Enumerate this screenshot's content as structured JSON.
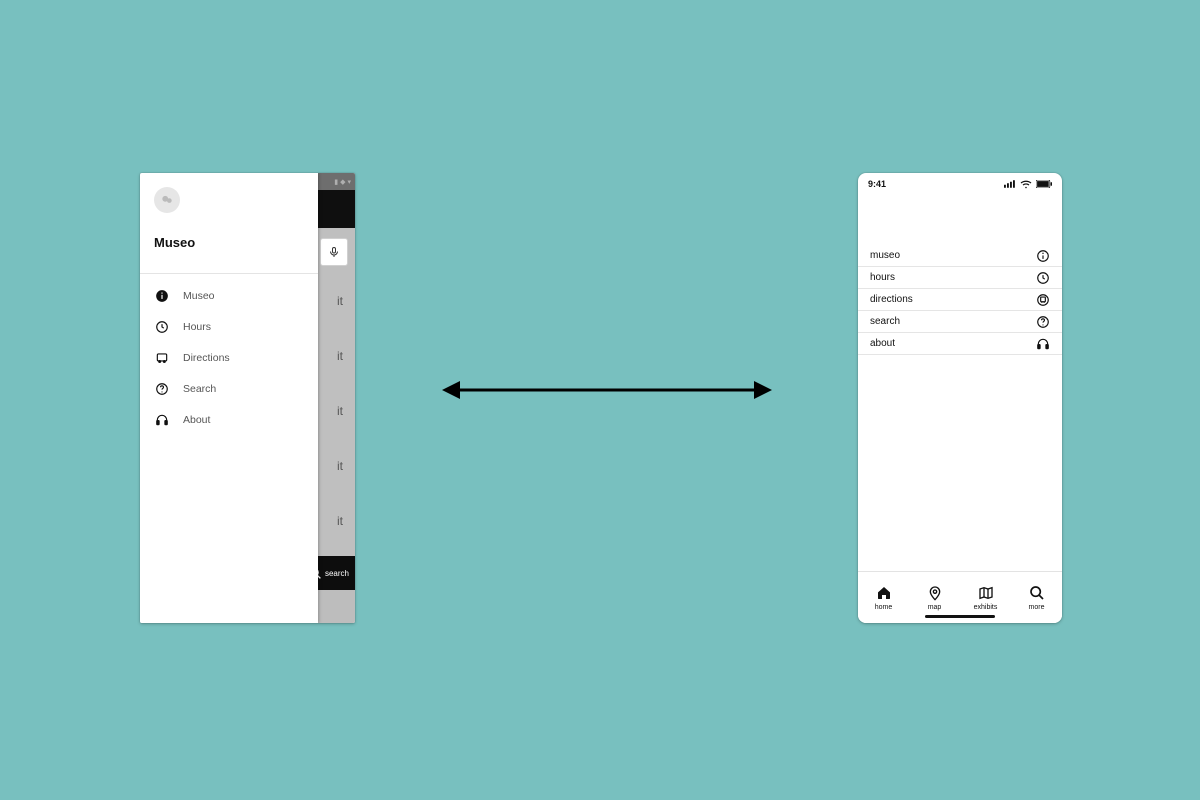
{
  "android": {
    "drawer": {
      "title": "Museo",
      "items": [
        {
          "label": "Museo",
          "icon": "info"
        },
        {
          "label": "Hours",
          "icon": "clock"
        },
        {
          "label": "Directions",
          "icon": "bus"
        },
        {
          "label": "Search",
          "icon": "help"
        },
        {
          "label": "About",
          "icon": "headphones"
        }
      ]
    },
    "underlying_items": [
      "it",
      "it",
      "it",
      "it",
      "it"
    ],
    "bottom_action": {
      "label": "search",
      "icon": "search"
    }
  },
  "ios": {
    "status_time": "9:41",
    "rows": [
      {
        "label": "museo",
        "icon": "info"
      },
      {
        "label": "hours",
        "icon": "clock"
      },
      {
        "label": "directions",
        "icon": "train"
      },
      {
        "label": "search",
        "icon": "help"
      },
      {
        "label": "about",
        "icon": "headphones"
      }
    ],
    "tabs": [
      {
        "label": "home",
        "icon": "home"
      },
      {
        "label": "map",
        "icon": "pin"
      },
      {
        "label": "exhibits",
        "icon": "map"
      },
      {
        "label": "more",
        "icon": "search"
      }
    ]
  }
}
